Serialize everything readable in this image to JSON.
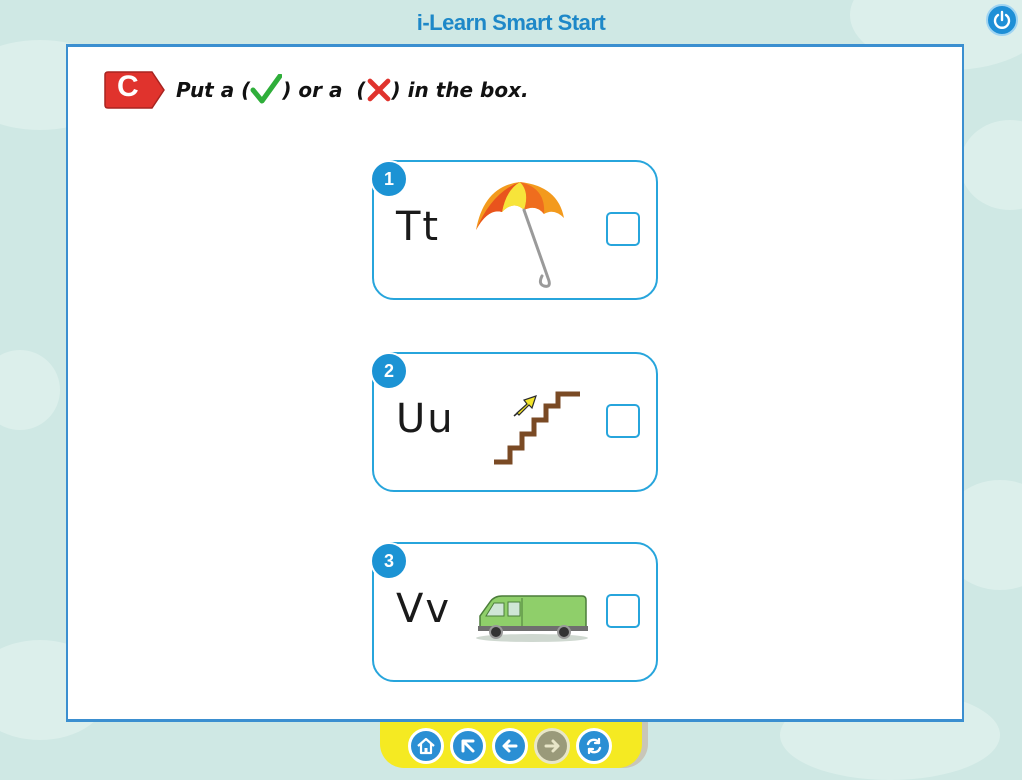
{
  "app": {
    "title": "i-Learn Smart Start"
  },
  "instruction": {
    "badge": "C",
    "part1": "Put a (",
    "part2": ") or a  (",
    "part3": ") in the box.",
    "icons": [
      "check-mark-icon",
      "cross-mark-icon"
    ]
  },
  "items": [
    {
      "number": "1",
      "letters": "Tt",
      "picture": "umbrella",
      "checked": false
    },
    {
      "number": "2",
      "letters": "Uu",
      "picture": "upstairs",
      "checked": false
    },
    {
      "number": "3",
      "letters": "Vv",
      "picture": "van",
      "checked": false
    }
  ],
  "nav": {
    "buttons": [
      "home-icon",
      "back-to-menu-icon",
      "previous-icon",
      "next-icon",
      "reset-icon"
    ],
    "disabled": [
      "next-icon"
    ]
  },
  "colors": {
    "accent": "#1e88c8",
    "card_border": "#27a5dc",
    "badge_red": "#e0332d",
    "nav_bar": "#f5ea22"
  }
}
